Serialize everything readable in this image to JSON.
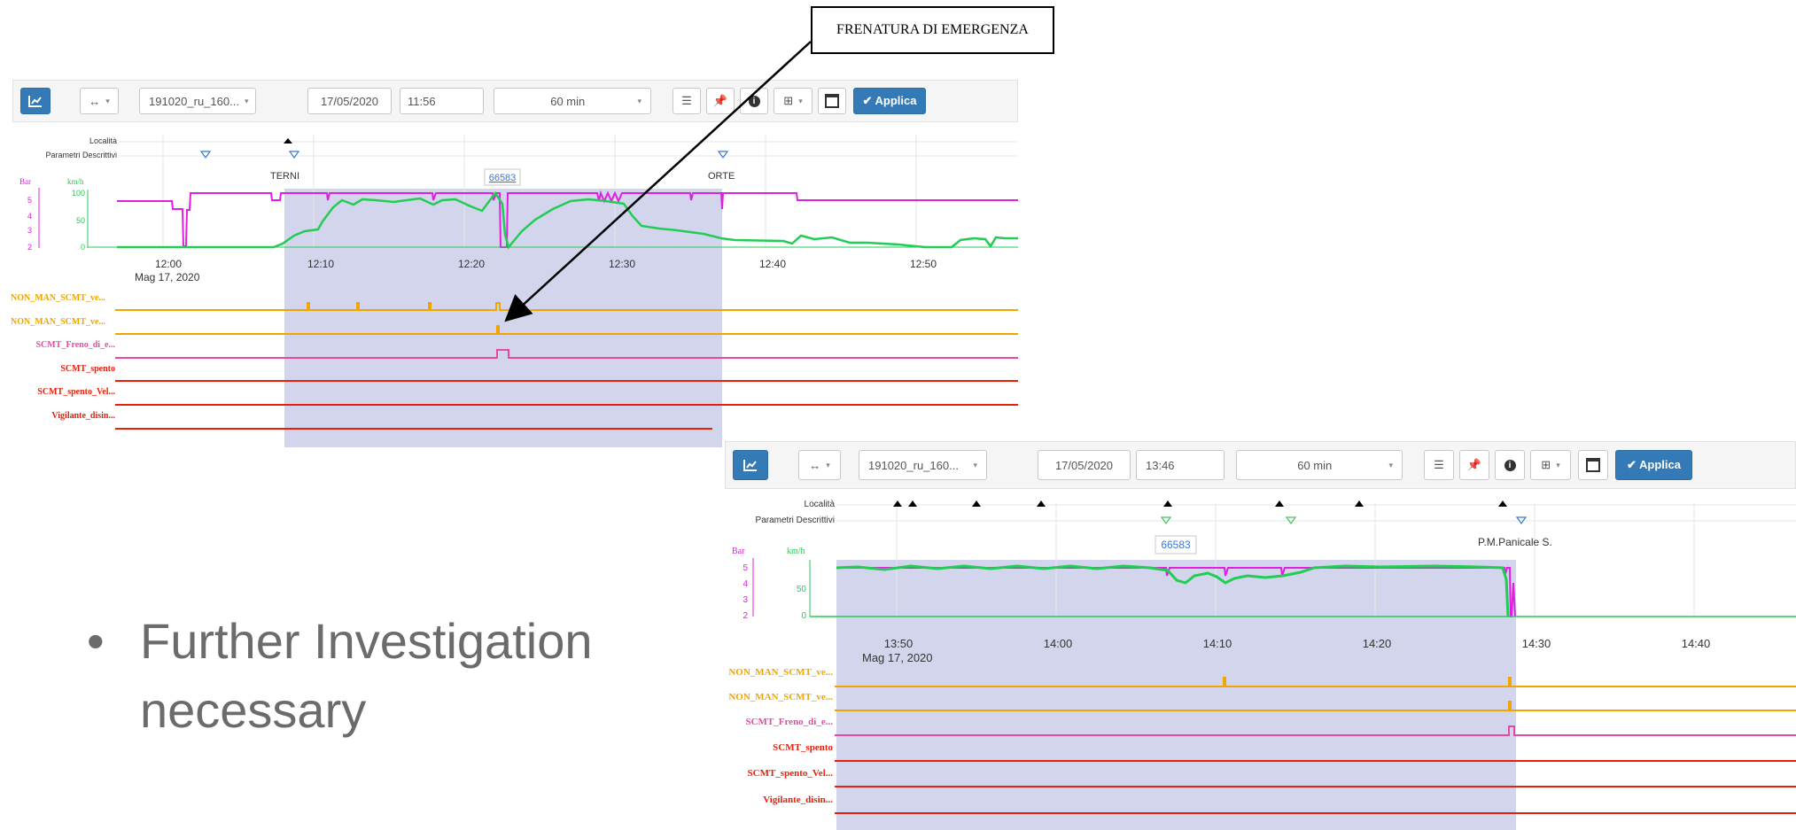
{
  "callout": {
    "text": "FRENATURA DI EMERGENZA"
  },
  "slide": {
    "bullet": "•",
    "lines": [
      "Further Investigation",
      "necessary"
    ]
  },
  "colors": {
    "bar": "#e020e0",
    "speed": "#22cc55",
    "selection": "#c8cae8",
    "orange": "#f0a500",
    "pink": "#e64aa0",
    "red": "#e8200a",
    "primary": "#337ab7"
  },
  "panels": [
    {
      "toolbar": {
        "chart_icon": "chart-icon",
        "arrows_label": "↔",
        "dataset": "191020_ru_160...",
        "date": "17/05/2020",
        "time": "11:56",
        "duration": "60 min",
        "icons": [
          "list-icon",
          "pin-icon",
          "info-icon",
          "grid-icon",
          "card-icon"
        ],
        "apply": "✔ Applica"
      },
      "rows": {
        "location": "Località",
        "params": "Parametri Descrittivi"
      },
      "units": {
        "bar": "Bar",
        "speed": "km/h"
      },
      "bar_ticks": [
        "5",
        "4",
        "3",
        "2"
      ],
      "speed_ticks": [
        "100",
        "50",
        "0"
      ],
      "places": [
        "TERNI",
        "ORTE"
      ],
      "marker": "66583",
      "time_ticks": [
        "12:00",
        "12:10",
        "12:20",
        "12:30",
        "12:40",
        "12:50"
      ],
      "date_label": "Mag 17, 2020",
      "signals": [
        "NON_MAN_SCMT_ve...",
        "NON_MAN_SCMT_ve...",
        "SCMT_Freno_di_e...",
        "SCMT_spento",
        "SCMT_spento_Vel...",
        "Vigilante_disin..."
      ],
      "zero": "0"
    },
    {
      "toolbar": {
        "chart_icon": "chart-icon",
        "arrows_label": "↔",
        "dataset": "191020_ru_160...",
        "date": "17/05/2020",
        "time": "13:46",
        "duration": "60 min",
        "icons": [
          "list-icon",
          "pin-icon",
          "info-icon",
          "grid-icon",
          "card-icon"
        ],
        "apply": "✔ Applica"
      },
      "rows": {
        "location": "Località",
        "params": "Parametri Descrittivi"
      },
      "units": {
        "bar": "Bar",
        "speed": "km/h"
      },
      "bar_ticks": [
        "5",
        "4",
        "3",
        "2"
      ],
      "speed_ticks": [
        "50",
        "0"
      ],
      "places": [
        "P.M.Panicale S."
      ],
      "marker": "66583",
      "time_ticks": [
        "13:50",
        "14:00",
        "14:10",
        "14:20",
        "14:30",
        "14:40"
      ],
      "date_label": "Mag 17, 2020",
      "signals": [
        "NON_MAN_SCMT_ve...",
        "NON_MAN_SCMT_ve...",
        "SCMT_Freno_di_e...",
        "SCMT_spento",
        "SCMT_spento_Vel...",
        "Vigilante_disin..."
      ],
      "zero": "0"
    }
  ]
}
